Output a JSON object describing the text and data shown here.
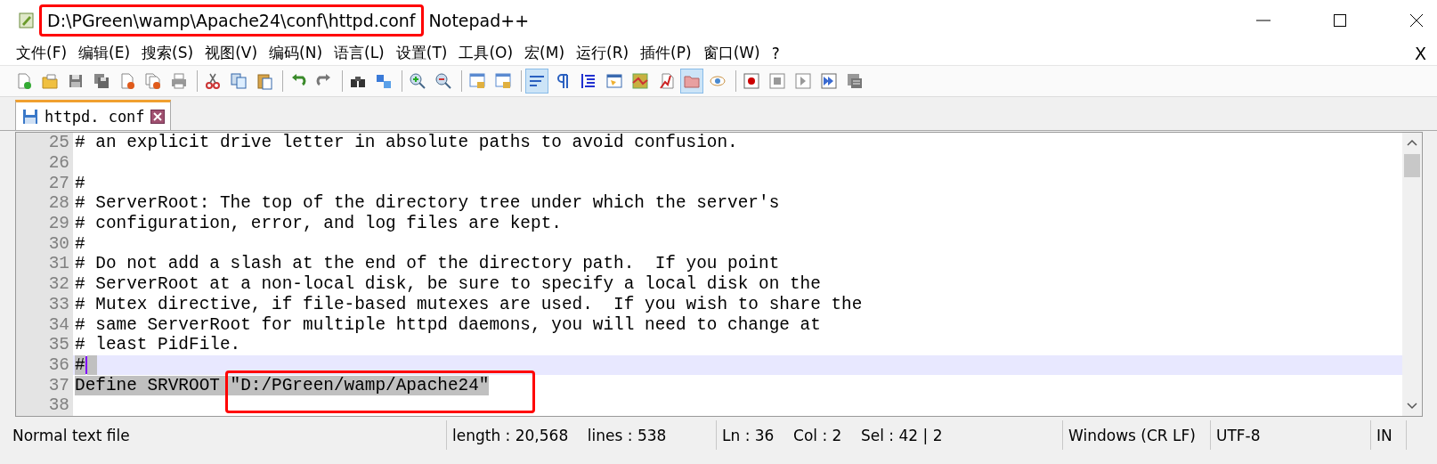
{
  "window": {
    "path": "D:\\PGreen\\wamp\\Apache24\\conf\\httpd.conf",
    "app": "Notepad++",
    "path_boxed": true
  },
  "menu": [
    "文件(F)",
    "编辑(E)",
    "搜索(S)",
    "视图(V)",
    "编码(N)",
    "语言(L)",
    "设置(T)",
    "工具(O)",
    "宏(M)",
    "运行(R)",
    "插件(P)",
    "窗口(W)",
    "?"
  ],
  "menu_close": "X",
  "toolbar": [
    [
      {
        "kind": "newfile",
        "on": false
      },
      {
        "kind": "open",
        "on": false
      },
      {
        "kind": "save",
        "on": false
      },
      {
        "kind": "saveall",
        "on": false
      },
      {
        "kind": "close",
        "on": false
      },
      {
        "kind": "closeall",
        "on": false
      },
      {
        "kind": "print",
        "on": false
      }
    ],
    [
      {
        "kind": "cut",
        "on": false
      },
      {
        "kind": "copy",
        "on": false
      },
      {
        "kind": "paste",
        "on": false
      }
    ],
    [
      {
        "kind": "undo",
        "on": false
      },
      {
        "kind": "redo",
        "on": false
      }
    ],
    [
      {
        "kind": "find",
        "on": false
      },
      {
        "kind": "replace",
        "on": false
      }
    ],
    [
      {
        "kind": "zoomin",
        "on": false
      },
      {
        "kind": "zoomout",
        "on": false
      }
    ],
    [
      {
        "kind": "syncv",
        "on": false
      },
      {
        "kind": "synch",
        "on": false
      }
    ],
    [
      {
        "kind": "wrap",
        "on": true
      },
      {
        "kind": "pilcrow",
        "on": false
      },
      {
        "kind": "indent",
        "on": false
      },
      {
        "kind": "udl",
        "on": false
      },
      {
        "kind": "map",
        "on": false
      },
      {
        "kind": "function",
        "on": false
      },
      {
        "kind": "folder",
        "on": true
      },
      {
        "kind": "eye",
        "on": false
      }
    ],
    [
      {
        "kind": "record",
        "on": false
      },
      {
        "kind": "stop",
        "on": false
      },
      {
        "kind": "play",
        "on": false
      },
      {
        "kind": "playmulti",
        "on": false
      },
      {
        "kind": "savemacro",
        "on": false
      }
    ]
  ],
  "tabs": [
    {
      "label": "httpd. conf",
      "selected": true
    }
  ],
  "lines": [
    {
      "number": "25",
      "text": "# an explicit drive letter in absolute paths to avoid confusion.",
      "current": false,
      "selected": false
    },
    {
      "number": "26",
      "current": false,
      "selected": false
    },
    {
      "number": "27",
      "text": "#",
      "current": false,
      "selected": false
    },
    {
      "number": "28",
      "text": "# ServerRoot: The top of the directory tree under which the server's",
      "current": false,
      "selected": false
    },
    {
      "number": "29",
      "text": "# configuration, error, and log files are kept.",
      "current": false,
      "selected": false
    },
    {
      "number": "30",
      "text": "#",
      "current": false,
      "selected": false
    },
    {
      "number": "31",
      "text": "# Do not add a slash at the end of the directory path.  If you point",
      "current": false,
      "selected": false
    },
    {
      "number": "32",
      "text": "# ServerRoot at a non-local disk, be sure to specify a local disk on the",
      "current": false,
      "selected": false
    },
    {
      "number": "33",
      "text": "# Mutex directive, if file-based mutexes are used.  If you wish to share the",
      "current": false,
      "selected": false
    },
    {
      "number": "34",
      "text": "# same ServerRoot for multiple httpd daemons, you will need to change at",
      "current": false,
      "selected": false
    },
    {
      "number": "35",
      "text": "# least PidFile.",
      "current": false,
      "selected": false
    },
    {
      "number": "36",
      "text": "#",
      "current": true,
      "selected": true
    },
    {
      "number": "37",
      "text": "Define SRVROOT ",
      "boxed_text": "\"D:/PGreen/wamp/Apache24\"",
      "current": false,
      "selected": true
    },
    {
      "number": "38",
      "current": false,
      "selected": false
    }
  ],
  "status_bar": [
    {
      "text": "Normal text file"
    },
    {
      "text": "length : 20,568    lines : 538"
    },
    {
      "text": "Ln : 36    Col : 2    Sel : 42 | 2"
    },
    {
      "text": "Windows (CR LF)"
    },
    {
      "text": "UTF-8"
    },
    {
      "text": "IN"
    }
  ]
}
